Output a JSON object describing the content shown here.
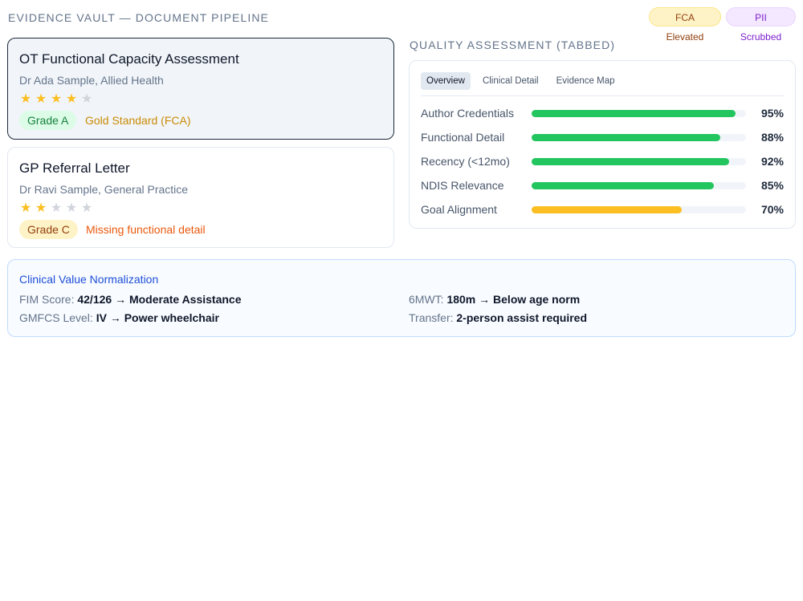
{
  "header": {
    "title": "EVIDENCE VAULT — DOCUMENT PIPELINE",
    "badges": [
      "FCA Elevated",
      "PII Scrubbed"
    ]
  },
  "documents": [
    {
      "title": "OT Functional Capacity Assessment",
      "author": "Dr Ada Sample, Allied Health",
      "rating": 4,
      "rating_max": 5,
      "grade": "Grade A",
      "note": "Gold Standard (FCA)",
      "selected": true
    },
    {
      "title": "GP Referral Letter",
      "author": "Dr Ravi Sample, General Practice",
      "rating": 2,
      "rating_max": 5,
      "grade": "Grade C",
      "note": "Missing functional detail",
      "selected": false
    }
  ],
  "quality": {
    "heading": "QUALITY ASSESSMENT (TABBED)",
    "tabs": [
      "Overview",
      "Clinical Detail",
      "Evidence Map"
    ],
    "active_tab": "Overview",
    "metrics": [
      {
        "label": "Author Credentials",
        "value": 95,
        "value_text": "95%",
        "color": "#22c55e"
      },
      {
        "label": "Functional Detail",
        "value": 88,
        "value_text": "88%",
        "color": "#22c55e"
      },
      {
        "label": "Recency (<12mo)",
        "value": 92,
        "value_text": "92%",
        "color": "#22c55e"
      },
      {
        "label": "NDIS Relevance",
        "value": 85,
        "value_text": "85%",
        "color": "#22c55e"
      },
      {
        "label": "Goal Alignment",
        "value": 70,
        "value_text": "70%",
        "color": "#fbbf24"
      }
    ]
  },
  "normalization": {
    "title": "Clinical Value Normalization",
    "items": [
      {
        "key": "FIM Score:",
        "value": "42/126 → Moderate Assistance"
      },
      {
        "key": "6MWT:",
        "value": "180m → Below age norm"
      },
      {
        "key": "GMFCS Level:",
        "value": "IV → Power wheelchair"
      },
      {
        "key": "Transfer:",
        "value": "2-person assist required"
      }
    ]
  },
  "colors": {
    "accent_blue": "#1d4ed8",
    "success": "#22c55e",
    "warning": "#fbbf24",
    "gold_text": "#ca8a04",
    "missing_text": "#ea580c"
  }
}
